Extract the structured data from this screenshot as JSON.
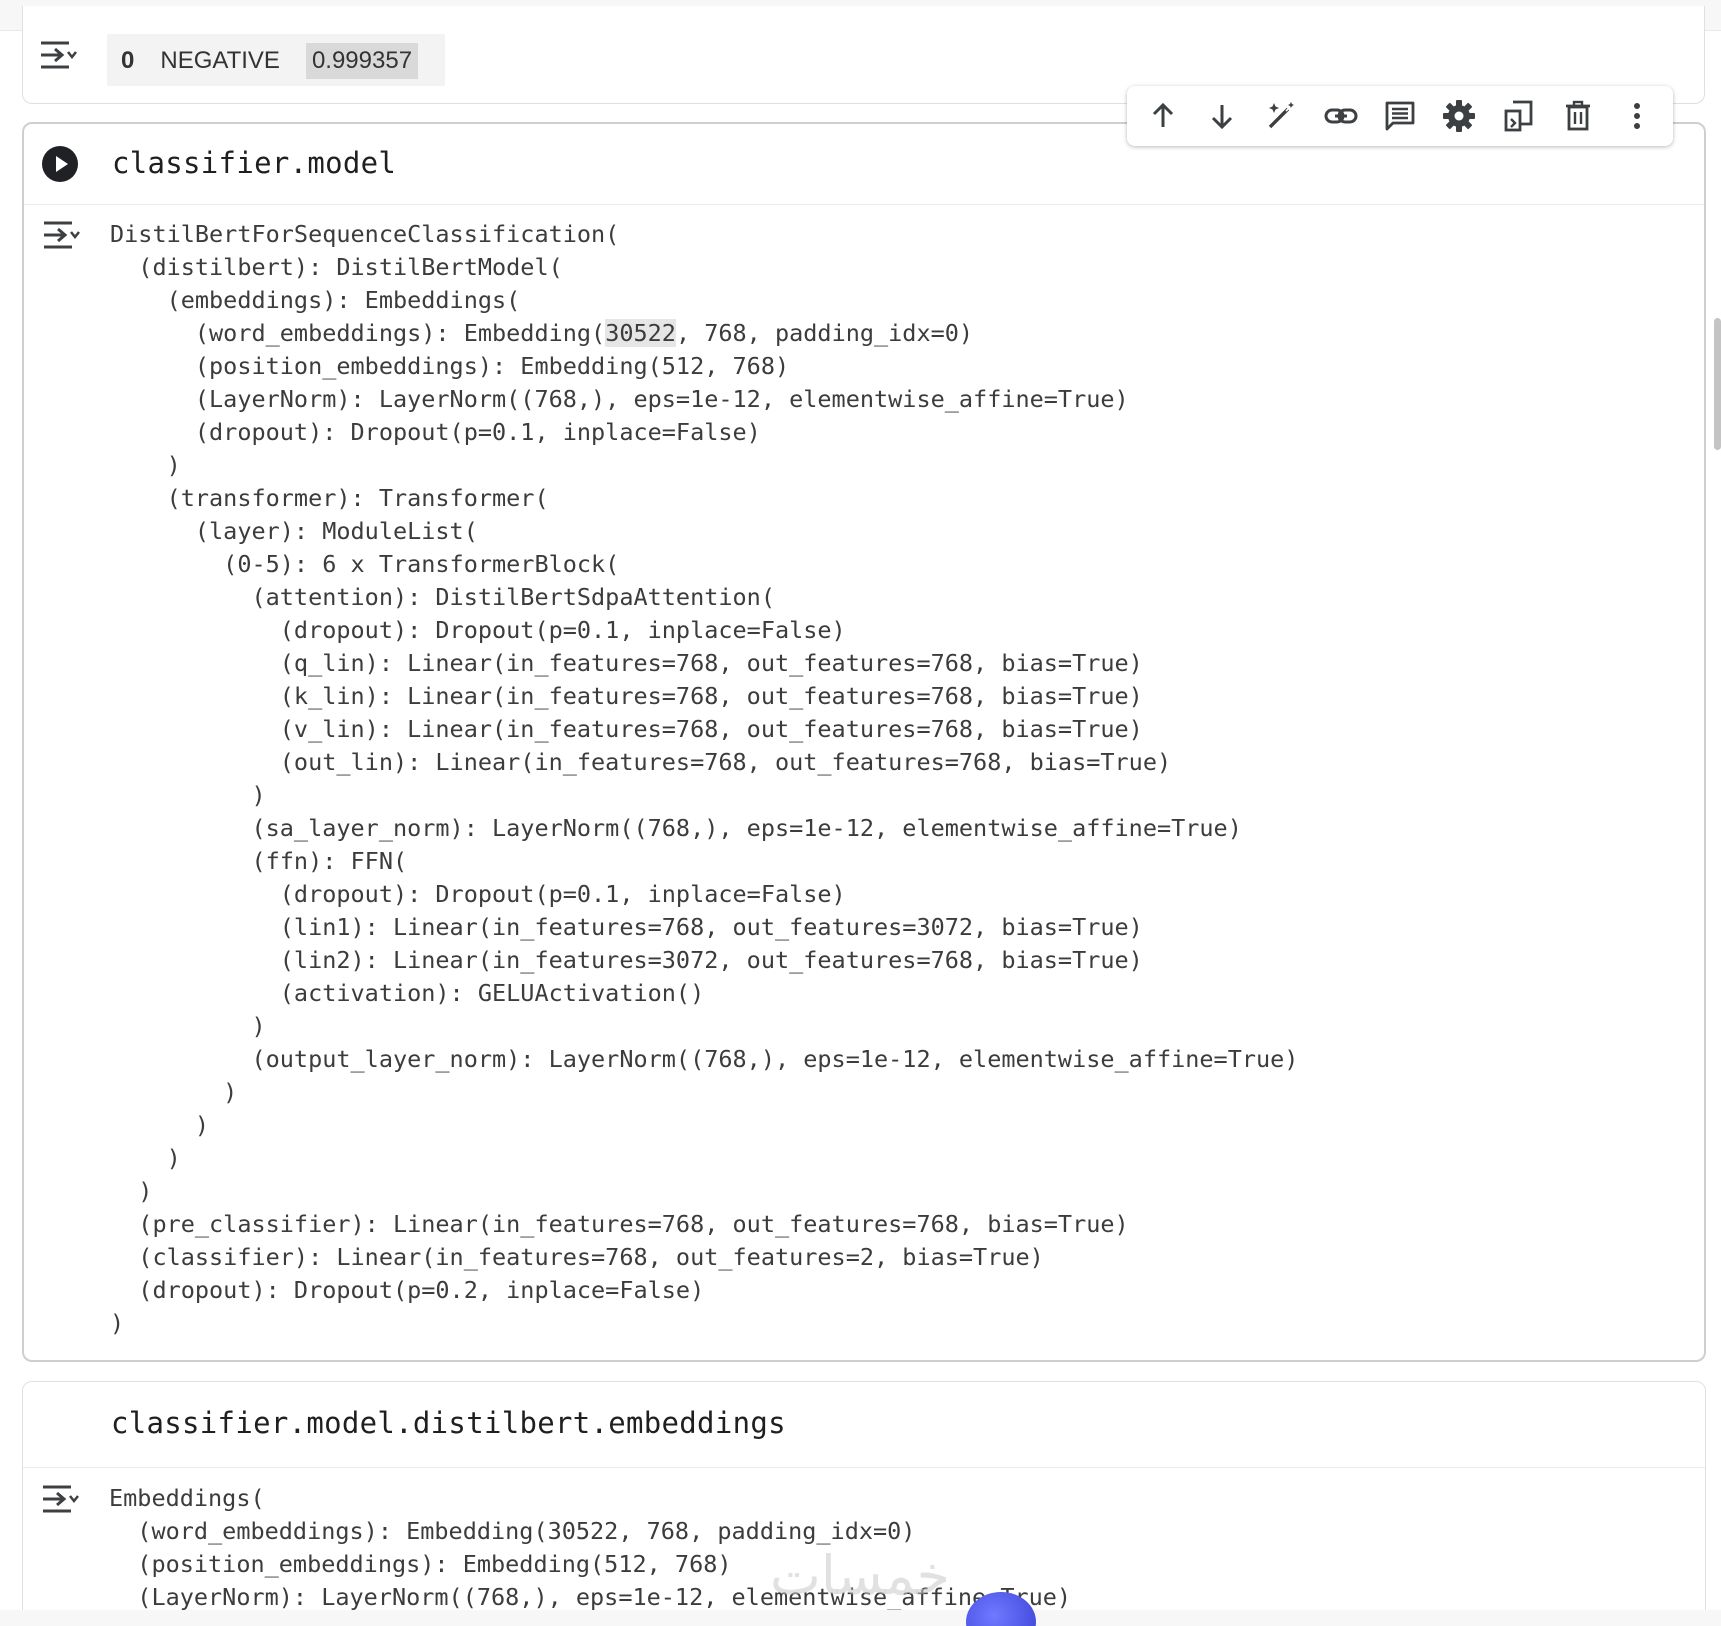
{
  "previous_cell": {
    "dataframe_row": {
      "index": "0",
      "label": "NEGATIVE",
      "score": "0.999357"
    }
  },
  "toolbar": {
    "buttons": [
      {
        "name": "move-up",
        "icon": "arrow-up-icon"
      },
      {
        "name": "move-down",
        "icon": "arrow-down-icon"
      },
      {
        "name": "edit",
        "icon": "magic-wand-icon"
      },
      {
        "name": "link",
        "icon": "link-icon"
      },
      {
        "name": "comment",
        "icon": "comment-icon"
      },
      {
        "name": "settings",
        "icon": "gear-icon"
      },
      {
        "name": "mirror",
        "icon": "mirror-cell-icon"
      },
      {
        "name": "delete",
        "icon": "trash-icon"
      },
      {
        "name": "more",
        "icon": "more-vert-icon"
      }
    ]
  },
  "model_cell": {
    "code": "classifier.model",
    "output_lines": [
      "DistilBertForSequenceClassification(",
      "  (distilbert): DistilBertModel(",
      "    (embeddings): Embeddings(",
      "      (word_embeddings): Embedding(30522, 768, padding_idx=0)",
      "      (position_embeddings): Embedding(512, 768)",
      "      (LayerNorm): LayerNorm((768,), eps=1e-12, elementwise_affine=True)",
      "      (dropout): Dropout(p=0.1, inplace=False)",
      "    )",
      "    (transformer): Transformer(",
      "      (layer): ModuleList(",
      "        (0-5): 6 x TransformerBlock(",
      "          (attention): DistilBertSdpaAttention(",
      "            (dropout): Dropout(p=0.1, inplace=False)",
      "            (q_lin): Linear(in_features=768, out_features=768, bias=True)",
      "            (k_lin): Linear(in_features=768, out_features=768, bias=True)",
      "            (v_lin): Linear(in_features=768, out_features=768, bias=True)",
      "            (out_lin): Linear(in_features=768, out_features=768, bias=True)",
      "          )",
      "          (sa_layer_norm): LayerNorm((768,), eps=1e-12, elementwise_affine=True)",
      "          (ffn): FFN(",
      "            (dropout): Dropout(p=0.1, inplace=False)",
      "            (lin1): Linear(in_features=768, out_features=3072, bias=True)",
      "            (lin2): Linear(in_features=3072, out_features=768, bias=True)",
      "            (activation): GELUActivation()",
      "          )",
      "          (output_layer_norm): LayerNorm((768,), eps=1e-12, elementwise_affine=True)",
      "        )",
      "      )",
      "    )",
      "  )",
      "  (pre_classifier): Linear(in_features=768, out_features=768, bias=True)",
      "  (classifier): Linear(in_features=768, out_features=2, bias=True)",
      "  (dropout): Dropout(p=0.2, inplace=False)",
      ")"
    ]
  },
  "embeddings_cell": {
    "code": "classifier.model.distilbert.embeddings",
    "output_lines": [
      "Embeddings(",
      "  (word_embeddings): Embedding(30522, 768, padding_idx=0)",
      "  (position_embeddings): Embedding(512, 768)",
      "  (LayerNorm): LayerNorm((768,), eps=1e-12, elementwise_affine=True)"
    ]
  },
  "watermark": "خمسات",
  "colors": {
    "icon": "#3c4043",
    "selection_highlight": "#e6e6e6",
    "cell_border": "#e0e0e0"
  }
}
